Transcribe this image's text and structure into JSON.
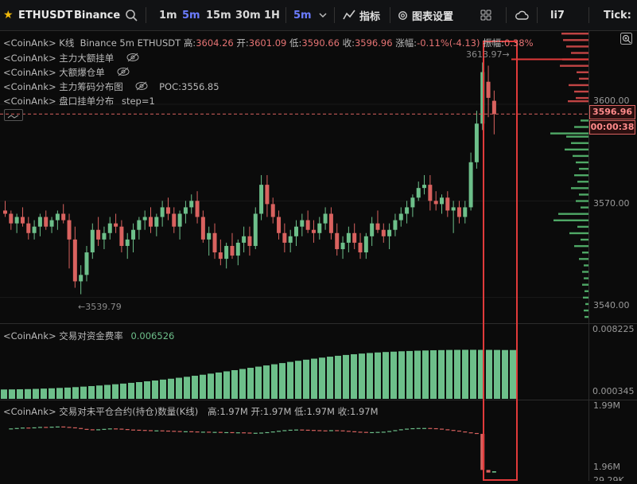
{
  "toolbar": {
    "symbol": "ETHUSDT",
    "exchange": "Binance",
    "timeframes": [
      "1m",
      "5m",
      "15m",
      "30m",
      "1H"
    ],
    "active_timeframe": "5m",
    "interval_dropdown": "5m",
    "indicators_label": "指标",
    "chart_settings_label": "图表设置",
    "user_label": "li7",
    "tick_label": "Tick:",
    "icons": [
      "star-icon",
      "search-icon",
      "indicators-icon",
      "gear-icon",
      "layout-grid-icon",
      "cloud-icon",
      "chevron-down-icon"
    ]
  },
  "legends": {
    "main": {
      "prefix": "<CoinAnk>",
      "name": "K线",
      "exchange": "Binance",
      "interval": "5m",
      "symbol": "ETHUSDT",
      "high_label": "高:",
      "high": "3604.26",
      "open_label": "开:",
      "open": "3601.09",
      "low_label": "低:",
      "low": "3590.66",
      "close_label": "收:",
      "close": "3596.96",
      "change_label": "涨幅:",
      "change": "-0.11%(-4.13)",
      "amplitude_label": "振幅:",
      "amplitude": "0.38%"
    },
    "ind1": {
      "prefix": "<CoinAnk>",
      "name": "主力大额挂单"
    },
    "ind2": {
      "prefix": "<CoinAnk>",
      "name": "大额爆仓单"
    },
    "ind3": {
      "prefix": "<CoinAnk>",
      "name": "主力筹码分布图",
      "poc": "POC:3556.85"
    },
    "ind4": {
      "prefix": "<CoinAnk>",
      "name": "盘口挂单分布",
      "step": "step=1"
    },
    "funding": {
      "prefix": "<CoinAnk>",
      "name": "交易对资金费率",
      "value": "0.006526"
    },
    "oi": {
      "prefix": "<CoinAnk>",
      "name": "交易对未平仓合约(持仓)数量(K线)",
      "high": "高:1.97M",
      "open": "开:1.97M",
      "low": "低:1.97M",
      "close": "收:1.97M"
    }
  },
  "price_axis": {
    "ticks": [
      "3600.00",
      "3570.00",
      "3540.00"
    ],
    "current_price": "3596.96",
    "countdown": "00:00:38",
    "high_marker": "3613.97",
    "low_marker": "3539.79"
  },
  "funding_axis": {
    "ticks": [
      "0.008225",
      "0.000345"
    ]
  },
  "oi_axis": {
    "ticks": [
      "1.99M",
      "1.96M",
      "29.29K"
    ]
  },
  "colors": {
    "up": "#6dbf8a",
    "down": "#d9625f",
    "background": "#0b0b0b",
    "accent": "#6b7cff",
    "highlight": "#e03a3a"
  },
  "chart_data": [
    {
      "type": "candlestick",
      "title": "ETHUSDT Binance 5m",
      "y_range": [
        3532,
        3623
      ],
      "y_ticks": [
        3600,
        3570,
        3540
      ],
      "candles": [
        [
          3567,
          3570,
          3565,
          3566
        ],
        [
          3566,
          3567,
          3561,
          3563
        ],
        [
          3563,
          3566,
          3560,
          3565
        ],
        [
          3565,
          3568,
          3562,
          3563
        ],
        [
          3563,
          3565,
          3558,
          3560
        ],
        [
          3560,
          3564,
          3558,
          3562
        ],
        [
          3562,
          3566,
          3559,
          3565
        ],
        [
          3565,
          3567,
          3561,
          3562
        ],
        [
          3562,
          3565,
          3560,
          3564
        ],
        [
          3564,
          3567,
          3561,
          3566
        ],
        [
          3566,
          3569,
          3563,
          3564
        ],
        [
          3564,
          3566,
          3549,
          3558
        ],
        [
          3558,
          3562,
          3543,
          3545
        ],
        [
          3545,
          3550,
          3541,
          3547
        ],
        [
          3547,
          3556,
          3545,
          3554
        ],
        [
          3554,
          3563,
          3552,
          3561
        ],
        [
          3561,
          3565,
          3556,
          3558
        ],
        [
          3558,
          3562,
          3555,
          3560
        ],
        [
          3560,
          3565,
          3558,
          3563
        ],
        [
          3563,
          3566,
          3560,
          3562
        ],
        [
          3562,
          3564,
          3554,
          3556
        ],
        [
          3556,
          3560,
          3552,
          3558
        ],
        [
          3558,
          3563,
          3554,
          3561
        ],
        [
          3561,
          3565,
          3558,
          3564
        ],
        [
          3564,
          3567,
          3561,
          3565
        ],
        [
          3565,
          3568,
          3560,
          3562
        ],
        [
          3562,
          3566,
          3559,
          3565
        ],
        [
          3565,
          3570,
          3562,
          3568
        ],
        [
          3568,
          3571,
          3564,
          3566
        ],
        [
          3566,
          3568,
          3560,
          3562
        ],
        [
          3562,
          3567,
          3558,
          3566
        ],
        [
          3566,
          3570,
          3563,
          3568
        ],
        [
          3568,
          3572,
          3566,
          3570
        ],
        [
          3570,
          3573,
          3563,
          3565
        ],
        [
          3565,
          3567,
          3557,
          3558
        ],
        [
          3558,
          3562,
          3553,
          3560
        ],
        [
          3560,
          3563,
          3552,
          3554
        ],
        [
          3554,
          3558,
          3550,
          3552
        ],
        [
          3552,
          3557,
          3549,
          3556
        ],
        [
          3556,
          3560,
          3552,
          3553
        ],
        [
          3553,
          3558,
          3550,
          3557
        ],
        [
          3557,
          3562,
          3554,
          3559
        ],
        [
          3559,
          3562,
          3553,
          3556
        ],
        [
          3556,
          3568,
          3555,
          3566
        ],
        [
          3566,
          3578,
          3564,
          3575
        ],
        [
          3575,
          3578,
          3565,
          3569
        ],
        [
          3569,
          3571,
          3563,
          3565
        ],
        [
          3565,
          3567,
          3558,
          3560
        ],
        [
          3560,
          3563,
          3554,
          3557
        ],
        [
          3557,
          3561,
          3554,
          3559
        ],
        [
          3559,
          3564,
          3556,
          3562
        ],
        [
          3562,
          3566,
          3559,
          3564
        ],
        [
          3564,
          3567,
          3560,
          3561
        ],
        [
          3561,
          3564,
          3557,
          3560
        ],
        [
          3560,
          3565,
          3558,
          3563
        ],
        [
          3563,
          3568,
          3561,
          3566
        ],
        [
          3566,
          3568,
          3558,
          3560
        ],
        [
          3560,
          3563,
          3553,
          3555
        ],
        [
          3555,
          3559,
          3552,
          3557
        ],
        [
          3557,
          3562,
          3554,
          3560
        ],
        [
          3560,
          3563,
          3555,
          3557
        ],
        [
          3557,
          3560,
          3552,
          3554
        ],
        [
          3554,
          3560,
          3552,
          3559
        ],
        [
          3559,
          3565,
          3556,
          3563
        ],
        [
          3563,
          3567,
          3560,
          3561
        ],
        [
          3561,
          3563,
          3557,
          3559
        ],
        [
          3559,
          3563,
          3555,
          3561
        ],
        [
          3561,
          3566,
          3559,
          3564
        ],
        [
          3564,
          3568,
          3562,
          3566
        ],
        [
          3566,
          3570,
          3563,
          3568
        ],
        [
          3568,
          3572,
          3565,
          3571
        ],
        [
          3571,
          3576,
          3570,
          3574
        ],
        [
          3574,
          3578,
          3572,
          3575
        ],
        [
          3575,
          3578,
          3567,
          3570
        ],
        [
          3570,
          3573,
          3567,
          3569
        ],
        [
          3569,
          3572,
          3566,
          3571
        ],
        [
          3571,
          3573,
          3565,
          3567
        ],
        [
          3567,
          3570,
          3560,
          3568
        ],
        [
          3568,
          3570,
          3563,
          3565
        ],
        [
          3565,
          3570,
          3563,
          3568
        ],
        [
          3568,
          3585,
          3567,
          3582
        ],
        [
          3582,
          3598,
          3580,
          3594
        ],
        [
          3594,
          3613,
          3592,
          3610
        ],
        [
          3607,
          3612,
          3596,
          3602
        ],
        [
          3601.09,
          3604.26,
          3590.66,
          3596.96
        ]
      ]
    },
    {
      "type": "bar",
      "title": "交易对资金费率",
      "value": 0.006526,
      "y_range": [
        0.000345,
        0.008225
      ],
      "values": [
        0.00118,
        0.00119,
        0.00121,
        0.00123,
        0.00126,
        0.0013,
        0.00134,
        0.00139,
        0.00144,
        0.0015,
        0.00157,
        0.00164,
        0.00172,
        0.0018,
        0.00189,
        0.00198,
        0.00208,
        0.00218,
        0.00229,
        0.0024,
        0.00252,
        0.00264,
        0.00277,
        0.0029,
        0.00304,
        0.00318,
        0.00333,
        0.00348,
        0.00364,
        0.0038,
        0.00396,
        0.00412,
        0.00428,
        0.00444,
        0.0046,
        0.00476,
        0.00492,
        0.00507,
        0.00522,
        0.00536,
        0.0055,
        0.00563,
        0.00575,
        0.00586,
        0.00596,
        0.00605,
        0.00613,
        0.0062,
        0.00626,
        0.00631,
        0.00636,
        0.0064,
        0.00644,
        0.00647,
        0.0065,
        0.00652,
        0.00654,
        0.00655,
        0.00656,
        0.00656,
        0.00655,
        0.00655,
        0.00654,
        0.00653,
        0.00653
      ]
    },
    {
      "type": "candlestick",
      "title": "交易对未平仓合约(持仓)数量(K线)",
      "y_range": [
        1.956,
        1.993
      ],
      "series": [
        1.98,
        1.9801,
        1.9803,
        1.9805,
        1.9804,
        1.9806,
        1.9808,
        1.9807,
        1.9809,
        1.981,
        1.9808,
        1.9806,
        1.9803,
        1.9799,
        1.9797,
        1.9796,
        1.9797,
        1.9799,
        1.9801,
        1.98,
        1.9798,
        1.9796,
        1.9795,
        1.9794,
        1.9793,
        1.9792,
        1.9792,
        1.9791,
        1.979,
        1.9789,
        1.9788,
        1.9788,
        1.9787,
        1.9786,
        1.9786,
        1.9785,
        1.9785,
        1.9784,
        1.9784,
        1.9783,
        1.9783,
        1.9782,
        1.9781,
        1.9781,
        1.9782,
        1.9784,
        1.9787,
        1.979,
        1.9793,
        1.9795,
        1.9796,
        1.9795,
        1.9794,
        1.9793,
        1.9792,
        1.9791,
        1.9793,
        1.9792,
        1.979,
        1.9788,
        1.9786,
        1.9785,
        1.9784,
        1.9784,
        1.9785,
        1.9786,
        1.9789,
        1.9793,
        1.9797,
        1.98,
        1.9802,
        1.9803,
        1.9803,
        1.9802,
        1.98,
        1.9797,
        1.9794,
        1.9791,
        1.9787,
        1.9783,
        1.978,
        1.9776,
        1.961,
        1.9598,
        1.9604
      ]
    }
  ]
}
